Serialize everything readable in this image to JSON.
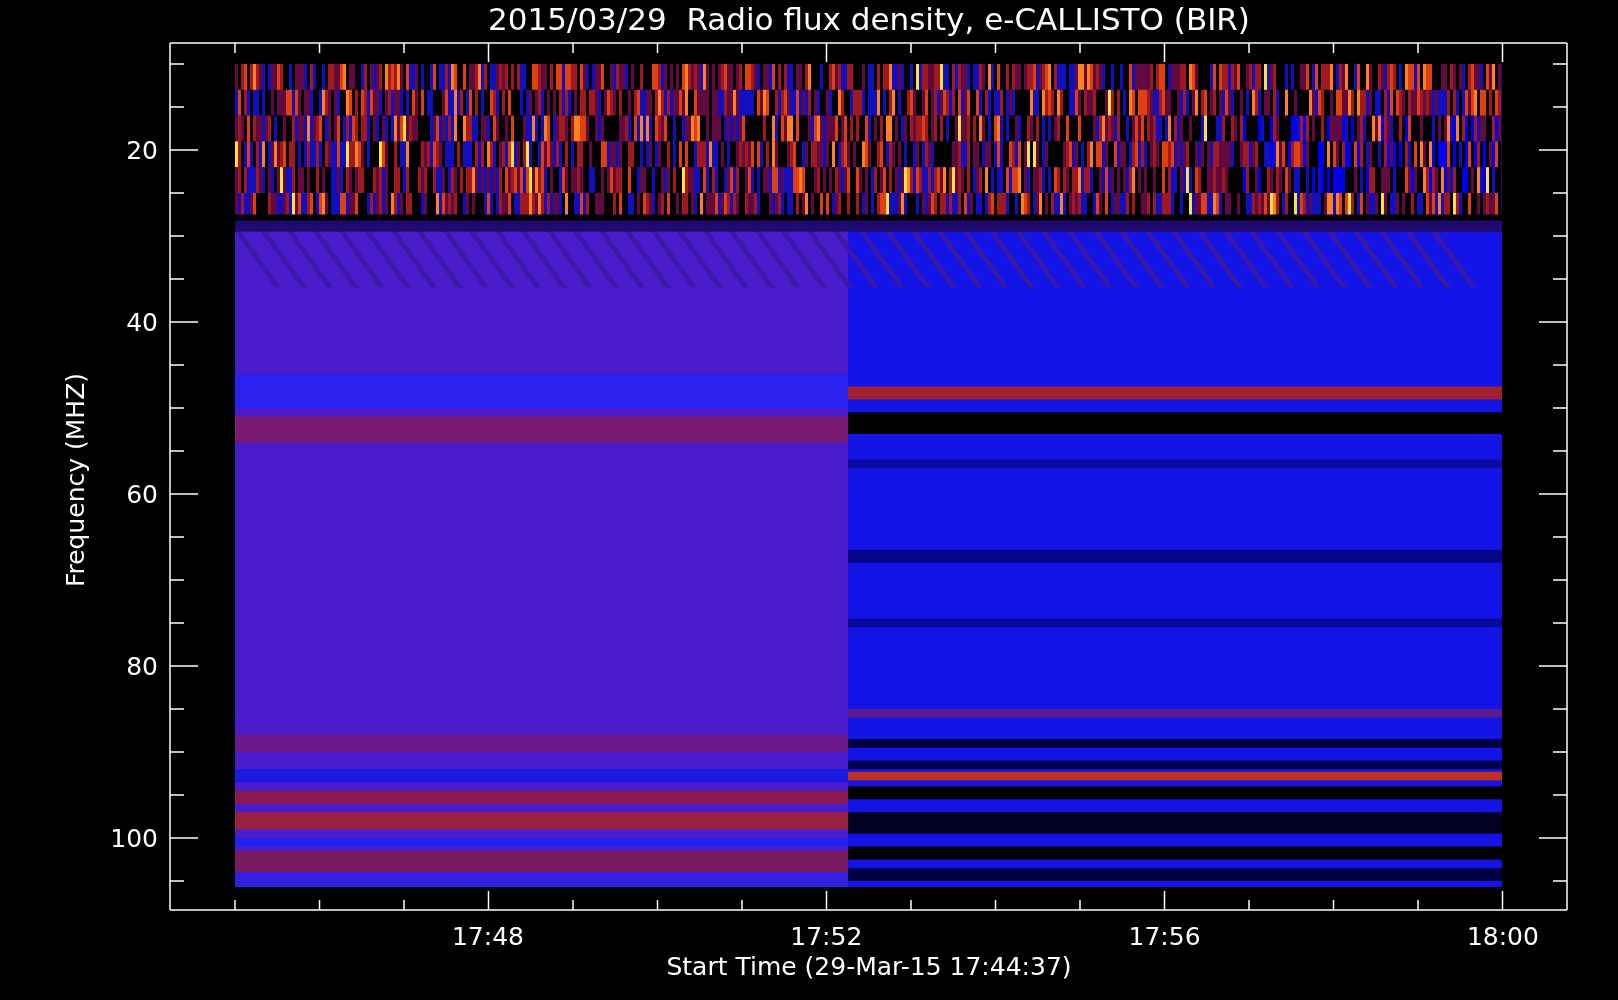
{
  "title": "2015/03/29  Radio flux density, e-CALLISTO (BIR)",
  "y_axis": {
    "label": "Frequency (MHZ)",
    "ticks": [
      "20",
      "40",
      "60",
      "80",
      "100"
    ]
  },
  "x_axis": {
    "label": "Start Time (29-Mar-15 17:44:37)",
    "ticks": [
      "17:48",
      "17:52",
      "17:56",
      "18:00"
    ]
  }
}
